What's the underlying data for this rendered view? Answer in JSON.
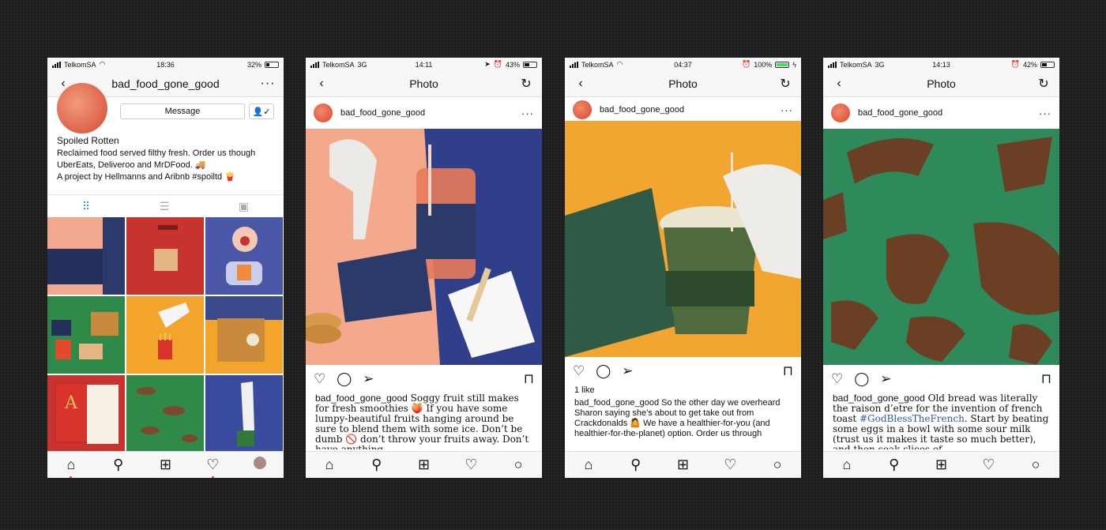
{
  "phones": [
    {
      "status": {
        "carrier": "TelkomSA",
        "network": "",
        "time": "18:36",
        "battery": "32%"
      },
      "header": {
        "title": "bad_food_gone_good",
        "back_icon": "back-chevron-icon",
        "more_icon": "more-dots-icon"
      },
      "profile": {
        "message_label": "Message",
        "name": "Spoiled Rotten",
        "bio_lines": [
          "Reclaimed food served filthy fresh. Order us though",
          "UberEats, Deliveroo and MrDFood. 🚚",
          "A project by Hellmanns and Aribnb #spoiltd 🍟"
        ]
      },
      "tabs": [
        "grid-icon",
        "list-icon",
        "tagged-icon"
      ],
      "grid_colors": [
        "#2b3a6b",
        "#c8332f",
        "#4a57a6",
        "#2f8a4a",
        "#f2a52a",
        "#3a4a8c",
        "#c8332f",
        "#2f8a4a",
        "#4a57a6"
      ]
    },
    {
      "status": {
        "carrier": "TelkomSA",
        "network": "3G",
        "time": "14:11",
        "battery": "43%"
      },
      "header": {
        "title": "Photo"
      },
      "post": {
        "username": "bad_food_gone_good",
        "caption_user": "bad_food_gone_good",
        "caption": "Soggy fruit still makes for fresh smoothies 🍑 If you have some lumpy-beautiful fruits hanging around be sure to blend them with some ice. Don’t be dumb 🚫 don’t throw your fruits away. Don’t have anything"
      }
    },
    {
      "status": {
        "carrier": "TelkomSA",
        "network": "",
        "time": "04:37",
        "battery": "100%"
      },
      "header": {
        "title": "Photo"
      },
      "post": {
        "username": "bad_food_gone_good",
        "likes": "1 like",
        "caption_user": "bad_food_gone_good",
        "caption": "So the other day we overheard Sharon saying she’s about to get take out from Crackdonalds 🤷 We have a healthier-for-you (and healthier-for-the-planet) option. Order us through"
      }
    },
    {
      "status": {
        "carrier": "TelkomSA",
        "network": "3G",
        "time": "14:13",
        "battery": "42%"
      },
      "header": {
        "title": "Photo"
      },
      "post": {
        "username": "bad_food_gone_good",
        "caption_user": "bad_food_gone_good",
        "caption_before": "Old bread was literally the raison d’etre for the invention of french toast ",
        "hashtag": "#GodBlessTheFrench",
        "caption_after": ". Start by beating some eggs in a bowl with some sour milk (trust us it makes it taste so much better), and then soak slices of"
      }
    }
  ],
  "colors": {
    "accent_blue": "#3897f0",
    "notif_red": "#e03a2f",
    "brand_orange": "#d9462f"
  }
}
